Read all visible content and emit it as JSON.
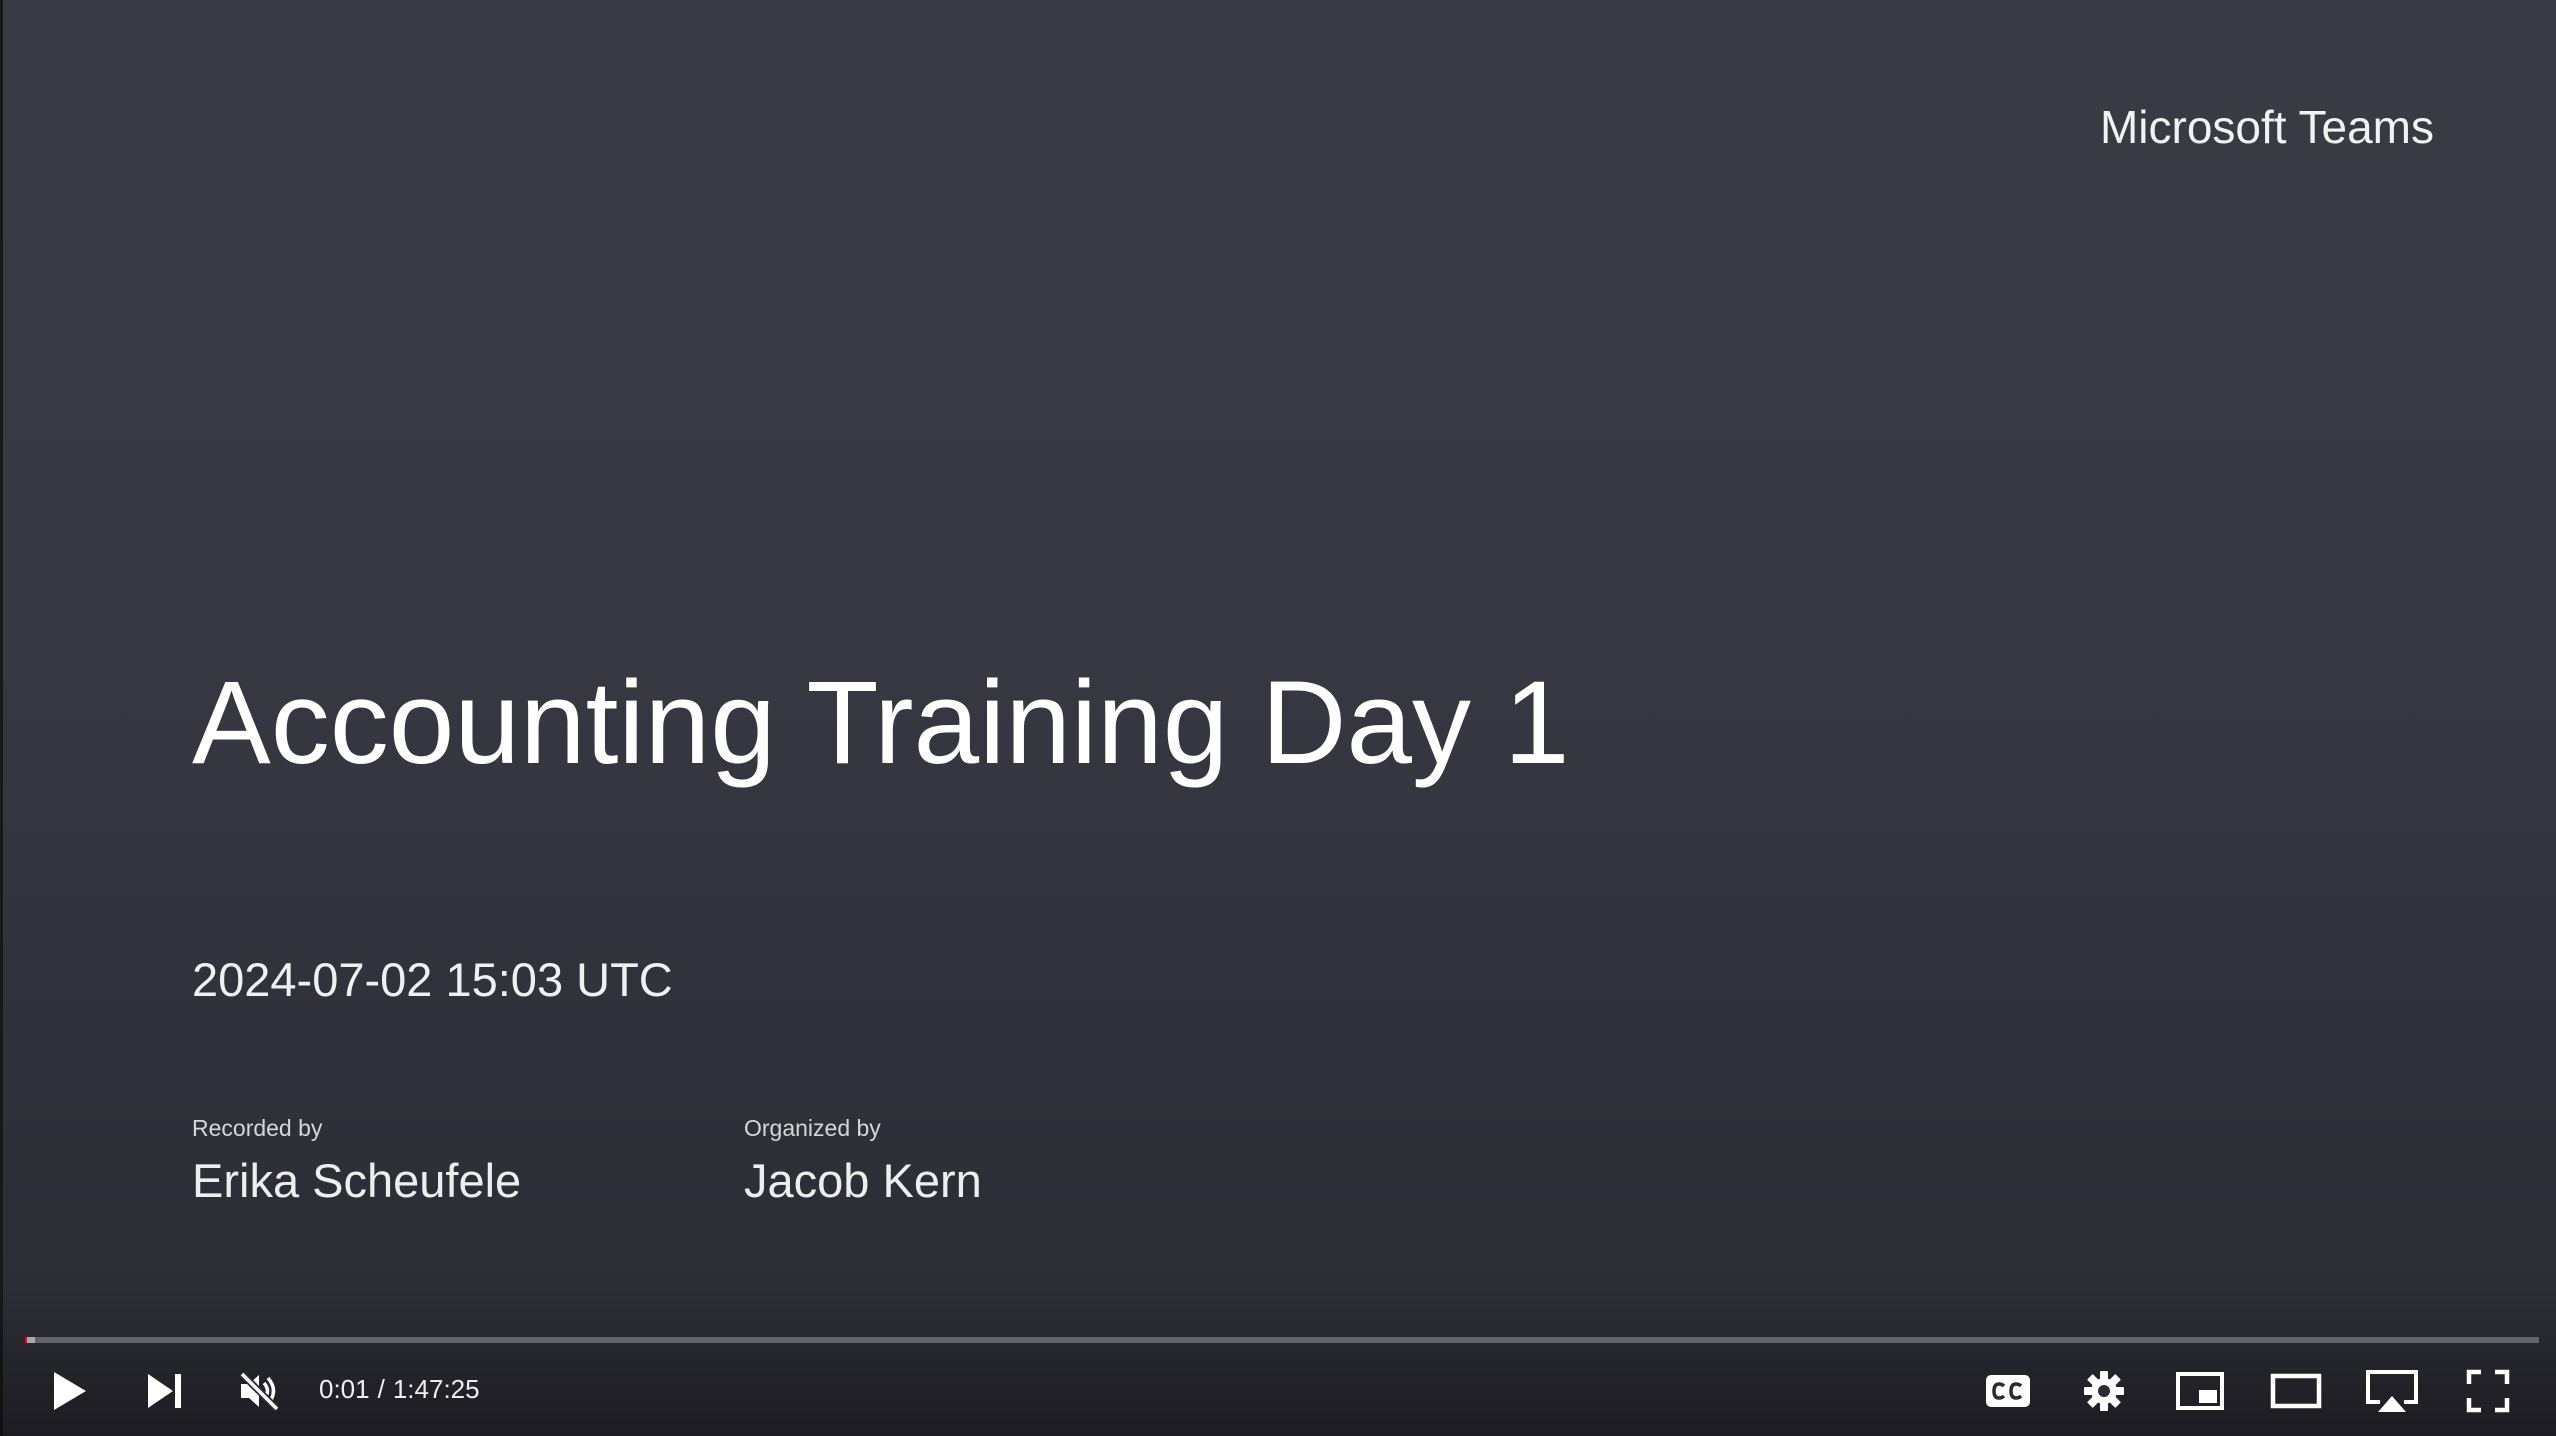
{
  "slide": {
    "brand": "Microsoft Teams",
    "title": "Accounting Training Day 1",
    "timestamp": "2024-07-02 15:03 UTC",
    "recorded_by_label": "Recorded by",
    "recorded_by_name": "Erika Scheufele",
    "organized_by_label": "Organized by",
    "organized_by_name": "Jacob Kern"
  },
  "player": {
    "current_time": "0:01",
    "separator": "/",
    "duration": "1:47:25",
    "progress_fraction": 0.0002,
    "loaded_fraction": 0.004,
    "muted": true,
    "colors": {
      "progress_played": "#ff0000",
      "icon": "#ffffff"
    },
    "icons": {
      "play": "play-icon",
      "next": "next-icon",
      "mute": "volume-muted-icon",
      "cc": "closed-captions-icon",
      "settings": "gear-icon",
      "miniplayer": "miniplayer-icon",
      "theater": "theater-mode-icon",
      "cast": "cast-icon",
      "fullscreen": "fullscreen-icon"
    }
  }
}
